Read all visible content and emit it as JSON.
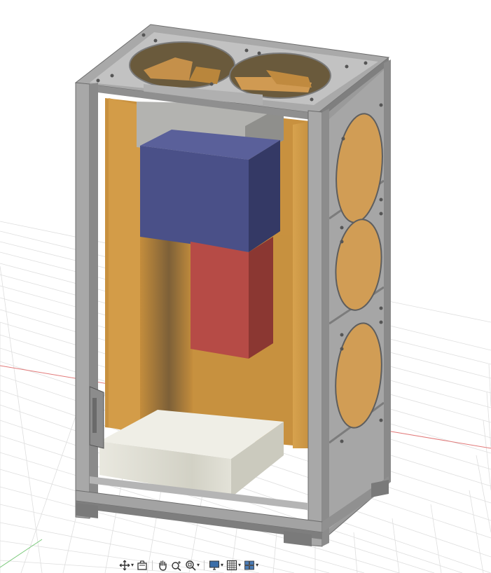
{
  "viewport": {
    "background": "#ffffff",
    "grid_color": "#dcdcdc",
    "x_axis_color": "#e06060",
    "y_axis_color": "#60c060"
  },
  "model": {
    "colors": {
      "frame_light": "#b9b9b9",
      "frame_mid": "#9c9c9c",
      "frame_dark": "#7a7a7a",
      "wood_light": "#d9a24e",
      "wood_dark": "#b57f2f",
      "blue_box": "#4b5189",
      "blue_box_side": "#353a66",
      "red_box": "#b84c47",
      "red_box_side": "#8d3833",
      "gray_box": "#b8b8b5",
      "gray_box_side": "#929290",
      "base_box": "#e7e6dc",
      "base_box_side": "#cfcec3",
      "fan_fill": "#d49e55"
    }
  },
  "toolbar": {
    "items": [
      {
        "name": "orbit-icon",
        "has_menu": true
      },
      {
        "name": "look-at-icon",
        "has_menu": false
      },
      {
        "name": "pan-icon",
        "has_menu": false
      },
      {
        "name": "zoom-icon",
        "has_menu": false
      },
      {
        "name": "fit-icon",
        "has_menu": true
      },
      {
        "name": "display-settings-icon",
        "has_menu": true
      },
      {
        "name": "grid-settings-icon",
        "has_menu": true
      },
      {
        "name": "viewports-icon",
        "has_menu": true
      }
    ]
  }
}
